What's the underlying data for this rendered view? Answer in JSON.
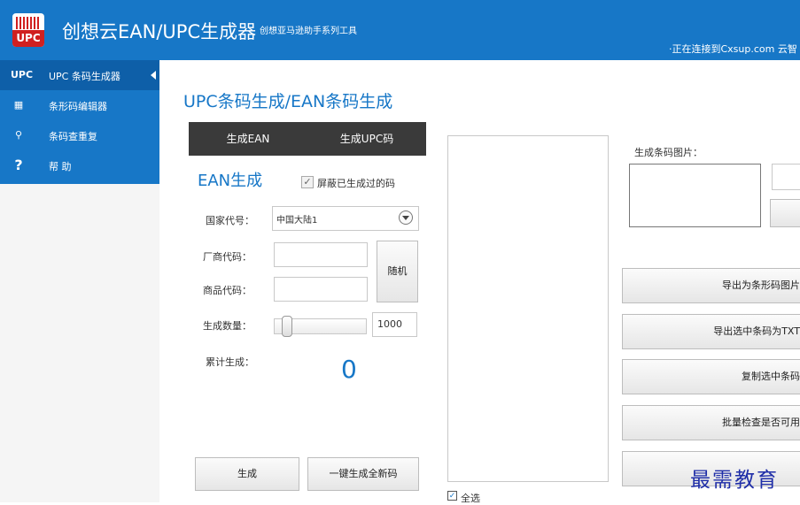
{
  "header": {
    "logo_text": "UPC",
    "title": "创想云EAN/UPC生成器",
    "subtitle": "创想亚马逊助手系列工具",
    "status": "·正在连接到Cxsup.com 云智"
  },
  "sidebar": {
    "items": [
      {
        "icon": "UPC",
        "label": "UPC 条码生成器"
      },
      {
        "icon": "▦",
        "label": "条形码编辑器"
      },
      {
        "icon": "⚲",
        "label": "条码查重复"
      },
      {
        "icon": "?",
        "label": "帮  助"
      }
    ]
  },
  "main": {
    "title": "UPC条码生成/EAN条码生成",
    "tabs": [
      {
        "label": "生成EAN"
      },
      {
        "label": "生成UPC码"
      }
    ],
    "ean_heading": "EAN生成",
    "shield_label": "屏蔽已生成过的码",
    "shield_checked": "✓",
    "country_label": "国家代号：",
    "country_value": "中国大陆1",
    "manufacturer_label": "厂商代码：",
    "product_label": "商品代码：",
    "random_button": "随机",
    "quantity_label": "生成数量：",
    "quantity_value": "1000",
    "total_label": "累计生成：",
    "total_value": "0",
    "generate_button": "生成",
    "generate_all_button": "一键生成全新码",
    "select_all_check": "✓",
    "select_all_label": "全选"
  },
  "right": {
    "image_label": "生成条码图片：",
    "actions": [
      "导出为条形码图片",
      "导出选中条码为TXT",
      "复制选中条码",
      "批量检查是否可用"
    ]
  },
  "watermark": "最需教育"
}
